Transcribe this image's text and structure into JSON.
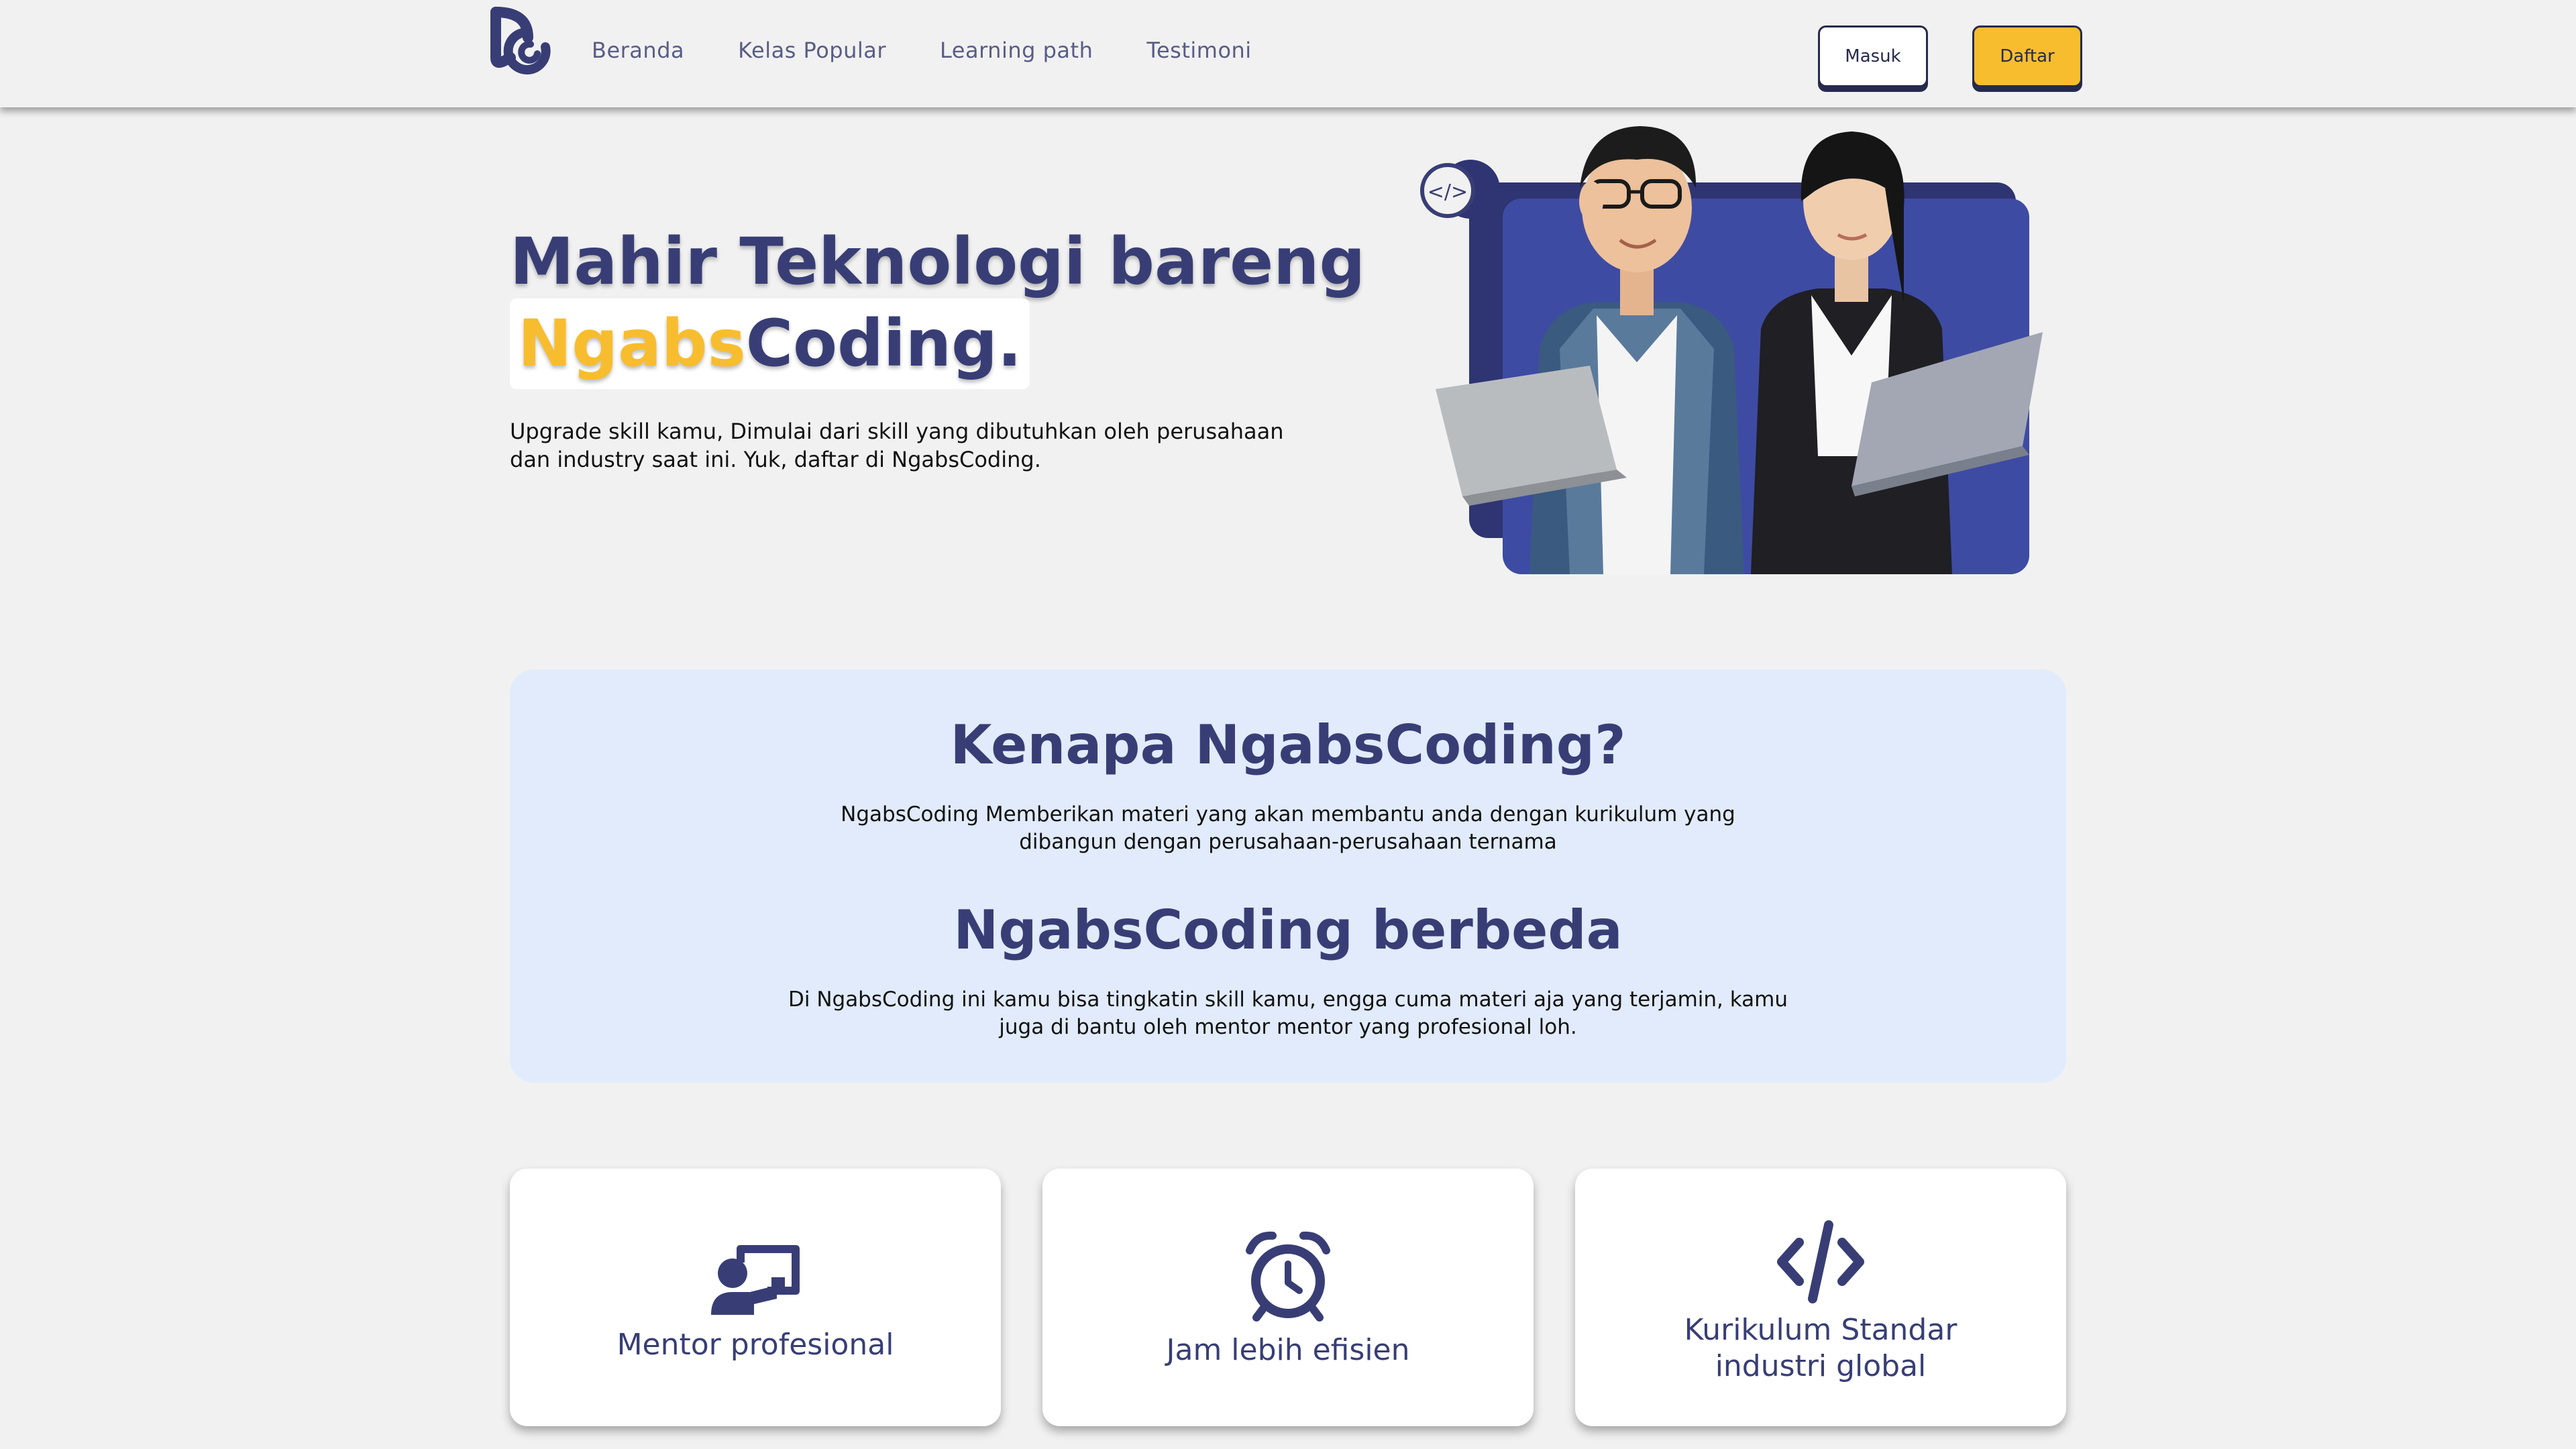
{
  "brand": {
    "name": "NgabsCoding",
    "logo_icon": "ngabscoding-logo-icon",
    "primary_color": "#383e75",
    "accent_color": "#f8bd2e"
  },
  "nav": {
    "links": [
      {
        "label": "Beranda"
      },
      {
        "label": "Kelas Popular"
      },
      {
        "label": "Learning path"
      },
      {
        "label": "Testimoni"
      }
    ],
    "login_label": "Masuk",
    "register_label": "Daftar"
  },
  "hero": {
    "title_line1": "Mahir Teknologi bareng",
    "title_highlight": "Ngabs",
    "title_rest": "Coding.",
    "description_line1": "Upgrade skill kamu, Dimulai dari skill yang dibutuhkan oleh perusahaan",
    "description_line2": "dan industry saat ini. Yuk, daftar di NgabsCoding.",
    "illustration_icon": "code-badge-icon"
  },
  "why": {
    "heading1": "Kenapa NgabsCoding?",
    "text1": "NgabsCoding Memberikan materi yang akan membantu anda dengan kurikulum yang dibangun dengan perusahaan-perusahaan ternama",
    "heading2": "NgabsCoding berbeda",
    "text2": "Di NgabsCoding ini kamu bisa tingkatin skill kamu, engga cuma materi aja yang terjamin, kamu juga di bantu oleh mentor mentor yang profesional loh."
  },
  "features": [
    {
      "label": "Mentor profesional",
      "icon": "chalkboard-teacher-icon"
    },
    {
      "label": "Jam lebih efisien",
      "icon": "alarm-clock-icon"
    },
    {
      "label_line1": "Kurikulum Standar",
      "label_line2": "industri global",
      "icon": "code-icon"
    }
  ]
}
